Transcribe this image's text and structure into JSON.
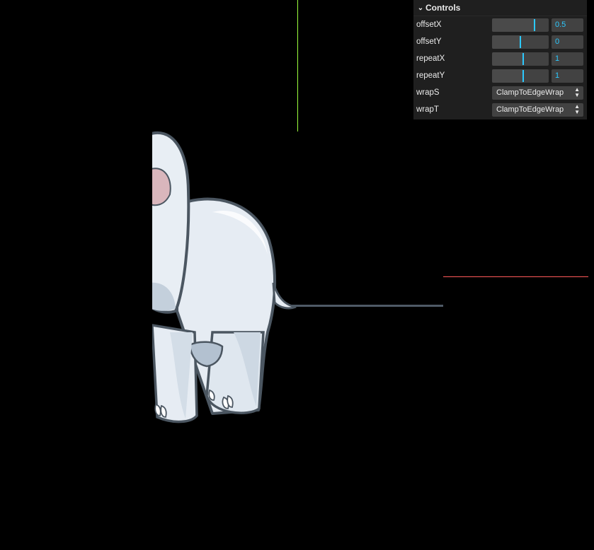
{
  "gui": {
    "title": "Controls",
    "controls": [
      {
        "label": "offsetX",
        "value": "0.5",
        "fraction": 0.75
      },
      {
        "label": "offsetY",
        "value": "0",
        "fraction": 0.5
      },
      {
        "label": "repeatX",
        "value": "1",
        "fraction": 0.55
      },
      {
        "label": "repeatY",
        "value": "1",
        "fraction": 0.55
      }
    ],
    "selects": [
      {
        "label": "wrapS",
        "value": "ClampToEdgeWrap"
      },
      {
        "label": "wrapT",
        "value": "ClampToEdgeWrap"
      }
    ]
  },
  "colors": {
    "background": "#000000",
    "panel": "#1f1f1f",
    "accent": "#2cc9ff",
    "axis_x": "#ff5a5a",
    "axis_y": "#9cff3c"
  }
}
